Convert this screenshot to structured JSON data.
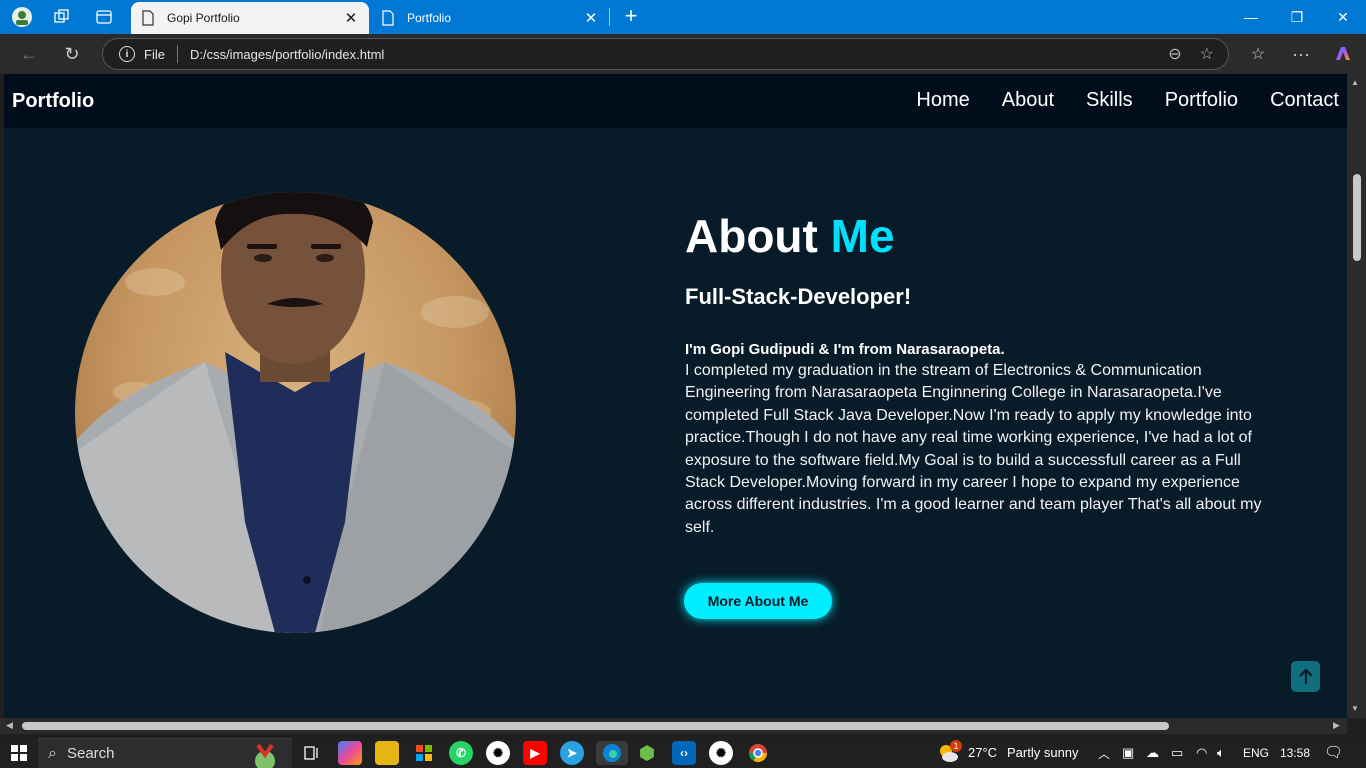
{
  "browser": {
    "tabs": [
      {
        "title": "Gopi Portfolio",
        "active": true
      },
      {
        "title": "Portfolio",
        "active": false
      }
    ],
    "address": {
      "scheme_label": "File",
      "url": "D:/css/images/portfolio/index.html"
    }
  },
  "site": {
    "brand": "Portfolio",
    "nav": [
      "Home",
      "About",
      "Skills",
      "Portfolio",
      "Contact"
    ],
    "about": {
      "title_plain": "About",
      "title_highlight": "Me",
      "subtitle": "Full-Stack-Developer!",
      "lead": "I'm Gopi Gudipudi & I'm from Narasaraopeta.",
      "body": "I completed my graduation in the stream of Electronics & Communication Engineering from Narasaraopeta Enginnering College in Narasaraopeta.I've completed Full Stack Java Developer.Now I'm ready to apply my knowledge into practice.Though I do not have any real time working experience, I've had a lot of exposure to the software field.My Goal is to build a successfull career as a Full Stack Developer.Moving forward in my career I hope to expand my experience across different industries. I'm a good learner and team player That's all about my self.",
      "button": "More About Me"
    },
    "colors": {
      "accent": "#00eeff",
      "background": "#081b29",
      "navbar": "#020d1c"
    }
  },
  "taskbar": {
    "search_placeholder": "Search",
    "weather_badge": "1",
    "temperature": "27°C",
    "weather_desc": "Partly sunny",
    "language": "ENG",
    "time": "13:58"
  }
}
